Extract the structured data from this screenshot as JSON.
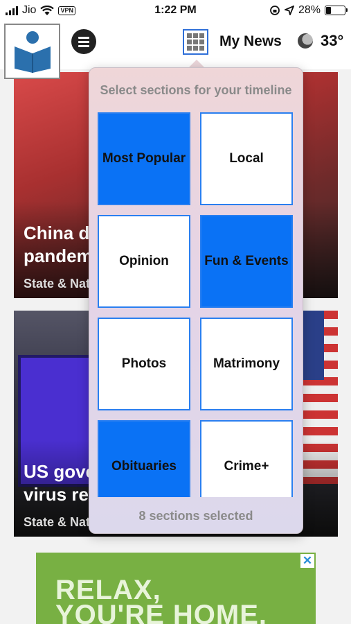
{
  "status_bar": {
    "carrier": "Jio",
    "vpn_label": "VPN",
    "time": "1:22 PM",
    "battery_percent": "28%",
    "battery_level": 0.28
  },
  "header": {
    "title": "My News",
    "temperature": "33°",
    "icons": [
      "logo-book-icon",
      "menu-icon",
      "grid-icon",
      "moon-icon"
    ]
  },
  "feed": [
    {
      "headline": "China di\npandem",
      "section": "State & Nat"
    },
    {
      "headline": "US gove\nvirus res",
      "section": "State & Nat"
    }
  ],
  "popover": {
    "title": "Select sections for your timeline",
    "footer": "8 sections selected",
    "tiles": [
      {
        "label": "Most Popular",
        "selected": true
      },
      {
        "label": "Local",
        "selected": false
      },
      {
        "label": "Opinion",
        "selected": false
      },
      {
        "label": "Fun & Events",
        "selected": true
      },
      {
        "label": "Photos",
        "selected": false
      },
      {
        "label": "Matrimony",
        "selected": false
      },
      {
        "label": "Obituaries",
        "selected": true
      },
      {
        "label": "Crime+",
        "selected": false
      }
    ]
  },
  "ad": {
    "text": "RELAX,\nYOU'RE HOME.",
    "close_label": "✕"
  },
  "colors": {
    "selected_tile": "#0a72f5",
    "tile_border": "#2a7ff0",
    "ad_green": "#78b043"
  }
}
